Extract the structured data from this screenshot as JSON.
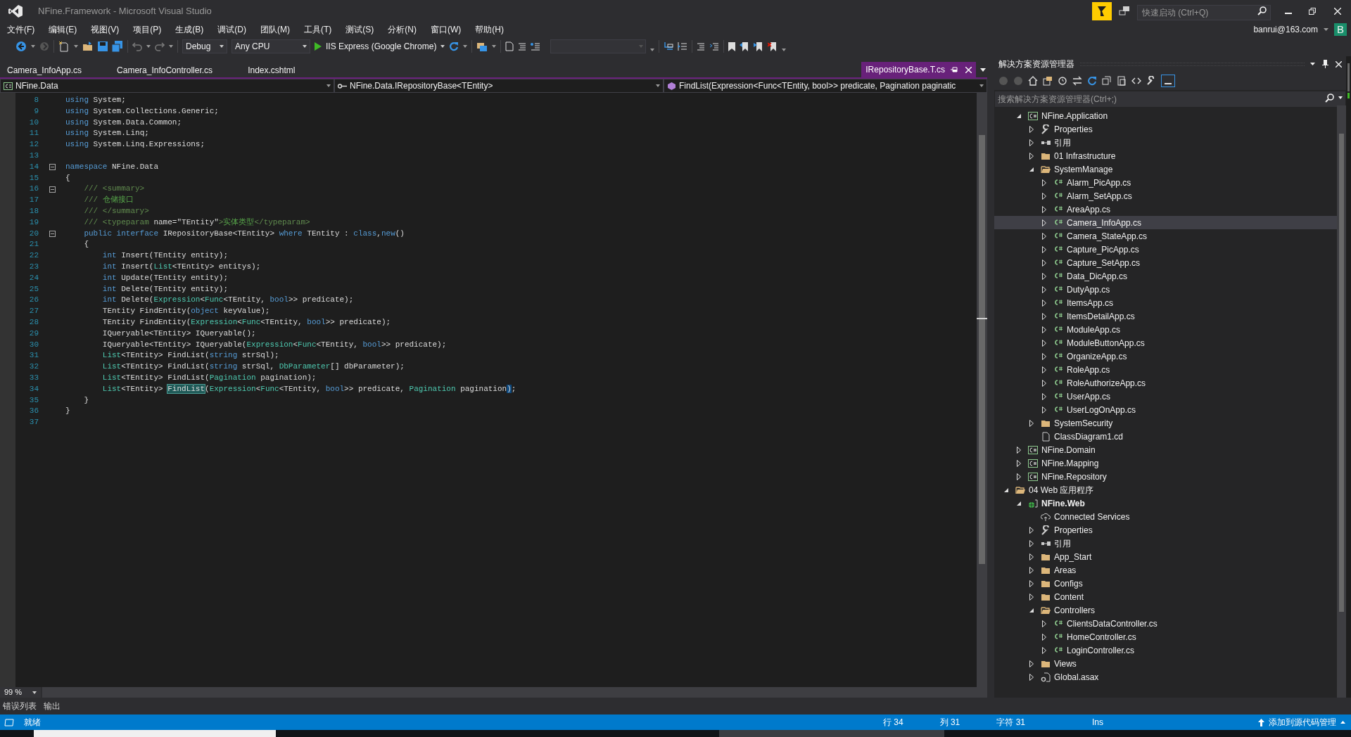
{
  "window": {
    "title": "NFine.Framework - Microsoft Visual Studio",
    "quick_launch": {
      "placeholder": "快速启动 (Ctrl+Q)"
    },
    "account": {
      "user": "banrui@163.com",
      "avatar": "B"
    }
  },
  "menu": [
    "文件(F)",
    "编辑(E)",
    "视图(V)",
    "项目(P)",
    "生成(B)",
    "调试(D)",
    "团队(M)",
    "工具(T)",
    "测试(S)",
    "分析(N)",
    "窗口(W)",
    "帮助(H)"
  ],
  "toolbar": {
    "configuration": "Debug",
    "platform": "Any CPU",
    "run_target": "IIS Express (Google Chrome)"
  },
  "tabs": [
    {
      "label": "Camera_InfoApp.cs",
      "selected": false
    },
    {
      "label": "Camera_InfoController.cs",
      "selected": false
    },
    {
      "label": "Index.cshtml",
      "selected": false
    },
    {
      "label": "IRepositoryBase.T.cs",
      "selected": true
    }
  ],
  "navigation": [
    "NFine.Data",
    "NFine.Data.IRepositoryBase<TEntity>",
    "FindList(Expression<Func<TEntity, bool>> predicate, Pagination paginatic"
  ],
  "code_lines": [
    {
      "number": "8",
      "fold": false,
      "segments": [
        {
          "text": "using",
          "kind": "kw"
        },
        {
          "text": " System;",
          "kind": "plain"
        }
      ]
    },
    {
      "number": "9",
      "fold": false,
      "segments": [
        {
          "text": "using",
          "kind": "kw"
        },
        {
          "text": " System.Collections.Generic;",
          "kind": "plain"
        }
      ]
    },
    {
      "number": "10",
      "fold": false,
      "segments": [
        {
          "text": "using",
          "kind": "kw"
        },
        {
          "text": " System.Data.Common;",
          "kind": "plain"
        }
      ]
    },
    {
      "number": "11",
      "fold": false,
      "segments": [
        {
          "text": "using",
          "kind": "kw"
        },
        {
          "text": " System.Linq;",
          "kind": "plain"
        }
      ]
    },
    {
      "number": "12",
      "fold": false,
      "segments": [
        {
          "text": "using",
          "kind": "kw"
        },
        {
          "text": " System.Linq.Expressions;",
          "kind": "plain"
        }
      ]
    },
    {
      "number": "13",
      "fold": false
    },
    {
      "number": "14",
      "fold": true,
      "segments": [
        {
          "text": "namespace",
          "kind": "kw"
        },
        {
          "text": " NFine.Data",
          "kind": "plain"
        }
      ]
    },
    {
      "number": "15",
      "fold": false,
      "segments": [
        {
          "text": "{",
          "kind": "plain"
        }
      ]
    },
    {
      "number": "16",
      "fold": true,
      "segments": [
        {
          "text": "    /// <summary>",
          "kind": "doc"
        }
      ]
    },
    {
      "number": "17",
      "fold": false,
      "segments": [
        {
          "text": "    /// ",
          "kind": "doc"
        },
        {
          "text": "仓储接口",
          "kind": "comment"
        }
      ]
    },
    {
      "number": "18",
      "fold": false,
      "segments": [
        {
          "text": "    /// </summary>",
          "kind": "doc"
        }
      ]
    },
    {
      "number": "19",
      "fold": false,
      "segments": [
        {
          "text": "    /// <typeparam ",
          "kind": "doc"
        },
        {
          "text": "name=\"TEntity\"",
          "kind": "plain"
        },
        {
          "text": ">",
          "kind": "doc"
        },
        {
          "text": "实体类型",
          "kind": "comment"
        },
        {
          "text": "</typeparam>",
          "kind": "doc"
        }
      ]
    },
    {
      "number": "20",
      "fold": true,
      "segments": [
        {
          "text": "    public interface",
          "kind": "kw"
        },
        {
          "text": " IRepositoryBase<TEntity> ",
          "kind": "plain"
        },
        {
          "text": "where",
          "kind": "kw"
        },
        {
          "text": " TEntity : ",
          "kind": "plain"
        },
        {
          "text": "class",
          "kind": "kw"
        },
        {
          "text": ",",
          "kind": "plain"
        },
        {
          "text": "new",
          "kind": "kw"
        },
        {
          "text": "()",
          "kind": "plain"
        }
      ]
    },
    {
      "number": "21",
      "fold": false,
      "segments": [
        {
          "text": "    {",
          "kind": "plain"
        }
      ]
    },
    {
      "number": "22",
      "fold": false,
      "segments": [
        {
          "text": "        int",
          "kind": "kw"
        },
        {
          "text": " Insert(TEntity entity);",
          "kind": "plain"
        }
      ]
    },
    {
      "number": "23",
      "fold": false,
      "segments": [
        {
          "text": "        int",
          "kind": "kw"
        },
        {
          "text": " Insert(",
          "kind": "plain"
        },
        {
          "text": "List",
          "kind": "type"
        },
        {
          "text": "<TEntity> entitys);",
          "kind": "plain"
        }
      ]
    },
    {
      "number": "24",
      "fold": false,
      "segments": [
        {
          "text": "        int",
          "kind": "kw"
        },
        {
          "text": " Update(TEntity entity);",
          "kind": "plain"
        }
      ]
    },
    {
      "number": "25",
      "fold": false,
      "segments": [
        {
          "text": "        int",
          "kind": "kw"
        },
        {
          "text": " Delete(TEntity entity);",
          "kind": "plain"
        }
      ]
    },
    {
      "number": "26",
      "fold": false,
      "segments": [
        {
          "text": "        int",
          "kind": "kw"
        },
        {
          "text": " Delete(",
          "kind": "plain"
        },
        {
          "text": "Expression",
          "kind": "type"
        },
        {
          "text": "<",
          "kind": "plain"
        },
        {
          "text": "Func",
          "kind": "type"
        },
        {
          "text": "<TEntity, ",
          "kind": "plain"
        },
        {
          "text": "bool",
          "kind": "kw"
        },
        {
          "text": ">> predicate);",
          "kind": "plain"
        }
      ]
    },
    {
      "number": "27",
      "fold": false,
      "segments": [
        {
          "text": "        TEntity FindEntity(",
          "kind": "plain"
        },
        {
          "text": "object",
          "kind": "kw"
        },
        {
          "text": " keyValue);",
          "kind": "plain"
        }
      ]
    },
    {
      "number": "28",
      "fold": false,
      "segments": [
        {
          "text": "        TEntity FindEntity(",
          "kind": "plain"
        },
        {
          "text": "Expression",
          "kind": "type"
        },
        {
          "text": "<",
          "kind": "plain"
        },
        {
          "text": "Func",
          "kind": "type"
        },
        {
          "text": "<TEntity, ",
          "kind": "plain"
        },
        {
          "text": "bool",
          "kind": "kw"
        },
        {
          "text": ">> predicate);",
          "kind": "plain"
        }
      ]
    },
    {
      "number": "29",
      "fold": false,
      "segments": [
        {
          "text": "        IQueryable<TEntity> IQueryable();",
          "kind": "plain"
        }
      ]
    },
    {
      "number": "30",
      "fold": false,
      "segments": [
        {
          "text": "        IQueryable<TEntity> IQueryable(",
          "kind": "plain"
        },
        {
          "text": "Expression",
          "kind": "type"
        },
        {
          "text": "<",
          "kind": "plain"
        },
        {
          "text": "Func",
          "kind": "type"
        },
        {
          "text": "<TEntity, ",
          "kind": "plain"
        },
        {
          "text": "bool",
          "kind": "kw"
        },
        {
          "text": ">> predicate);",
          "kind": "plain"
        }
      ]
    },
    {
      "number": "31",
      "fold": false,
      "segments": [
        {
          "text": "        List",
          "kind": "type"
        },
        {
          "text": "<TEntity> FindList(",
          "kind": "plain"
        },
        {
          "text": "string",
          "kind": "kw"
        },
        {
          "text": " strSql);",
          "kind": "plain"
        }
      ]
    },
    {
      "number": "32",
      "fold": false,
      "segments": [
        {
          "text": "        List",
          "kind": "type"
        },
        {
          "text": "<TEntity> FindList(",
          "kind": "plain"
        },
        {
          "text": "string",
          "kind": "kw"
        },
        {
          "text": " strSql, ",
          "kind": "plain"
        },
        {
          "text": "DbParameter",
          "kind": "type"
        },
        {
          "text": "[] dbParameter);",
          "kind": "plain"
        }
      ]
    },
    {
      "number": "33",
      "fold": false,
      "segments": [
        {
          "text": "        List",
          "kind": "type"
        },
        {
          "text": "<TEntity> FindList(",
          "kind": "plain"
        },
        {
          "text": "Pagination",
          "kind": "type"
        },
        {
          "text": " pagination);",
          "kind": "plain"
        }
      ]
    },
    {
      "number": "34",
      "fold": false,
      "segments": [
        {
          "text": "        List",
          "kind": "type"
        },
        {
          "text": "<TEntity> ",
          "kind": "plain"
        },
        {
          "text": "FindList",
          "kind": "match"
        },
        {
          "text": "(",
          "kind": "plain"
        },
        {
          "text": "Expression",
          "kind": "type"
        },
        {
          "text": "<",
          "kind": "plain"
        },
        {
          "text": "Func",
          "kind": "type"
        },
        {
          "text": "<TEntity, ",
          "kind": "plain"
        },
        {
          "text": "bool",
          "kind": "kw"
        },
        {
          "text": ">> predicate, ",
          "kind": "plain"
        },
        {
          "text": "Pagination",
          "kind": "type"
        },
        {
          "text": " pagination",
          "kind": "plain"
        },
        {
          "text": ")",
          "kind": "brace"
        },
        {
          "text": ";",
          "kind": "plain"
        }
      ]
    },
    {
      "number": "35",
      "fold": false,
      "segments": [
        {
          "text": "    }",
          "kind": "plain"
        }
      ]
    },
    {
      "number": "36",
      "fold": false,
      "segments": [
        {
          "text": "}",
          "kind": "plain"
        }
      ]
    },
    {
      "number": "37",
      "fold": false
    }
  ],
  "zoom": "99 %",
  "solution_explorer": {
    "title": "解决方案资源管理器",
    "search": {
      "placeholder": "搜索解决方案资源管理器(Ctrl+;)"
    },
    "continued_items": [
      {
        "label": "NFine.Application",
        "kind": "cs-project",
        "expanded": true,
        "selected": false,
        "children": [
          {
            "label": "Properties",
            "kind": "properties",
            "expanded": false,
            "selected": false
          },
          {
            "label": "引用",
            "kind": "references",
            "expanded": false,
            "selected": false
          },
          {
            "label": "01 Infrastructure",
            "kind": "folder",
            "expanded": false,
            "selected": false
          },
          {
            "label": "SystemManage",
            "kind": "folder",
            "expanded": true,
            "selected": false,
            "children": [
              {
                "label": "Alarm_PicApp.cs",
                "kind": "cs-file",
                "expanded": false,
                "selected": false
              },
              {
                "label": "Alarm_SetApp.cs",
                "kind": "cs-file",
                "expanded": false,
                "selected": false
              },
              {
                "label": "AreaApp.cs",
                "kind": "cs-file",
                "expanded": false,
                "selected": false
              },
              {
                "label": "Camera_InfoApp.cs",
                "kind": "cs-file",
                "expanded": false,
                "selected": true
              },
              {
                "label": "Camera_StateApp.cs",
                "kind": "cs-file",
                "expanded": false,
                "selected": false
              },
              {
                "label": "Capture_PicApp.cs",
                "kind": "cs-file",
                "expanded": false,
                "selected": false
              },
              {
                "label": "Capture_SetApp.cs",
                "kind": "cs-file",
                "expanded": false,
                "selected": false
              },
              {
                "label": "Data_DicApp.cs",
                "kind": "cs-file",
                "expanded": false,
                "selected": false
              },
              {
                "label": "DutyApp.cs",
                "kind": "cs-file",
                "expanded": false,
                "selected": false
              },
              {
                "label": "ItemsApp.cs",
                "kind": "cs-file",
                "expanded": false,
                "selected": false
              },
              {
                "label": "ItemsDetailApp.cs",
                "kind": "cs-file",
                "expanded": false,
                "selected": false
              },
              {
                "label": "ModuleApp.cs",
                "kind": "cs-file",
                "expanded": false,
                "selected": false
              },
              {
                "label": "ModuleButtonApp.cs",
                "kind": "cs-file",
                "expanded": false,
                "selected": false
              },
              {
                "label": "OrganizeApp.cs",
                "kind": "cs-file",
                "expanded": false,
                "selected": false
              },
              {
                "label": "RoleApp.cs",
                "kind": "cs-file",
                "expanded": false,
                "selected": false
              },
              {
                "label": "RoleAuthorizeApp.cs",
                "kind": "cs-file",
                "expanded": false,
                "selected": false
              },
              {
                "label": "UserApp.cs",
                "kind": "cs-file",
                "expanded": false,
                "selected": false
              },
              {
                "label": "UserLogOnApp.cs",
                "kind": "cs-file",
                "expanded": false,
                "selected": false
              }
            ]
          },
          {
            "label": "SystemSecurity",
            "kind": "folder",
            "expanded": false,
            "selected": false
          },
          {
            "label": "ClassDiagram1.cd",
            "kind": "document",
            "selected": false
          }
        ]
      },
      {
        "label": "NFine.Domain",
        "kind": "cs-project",
        "expanded": false,
        "selected": false
      },
      {
        "label": "NFine.Mapping",
        "kind": "cs-project",
        "expanded": false,
        "selected": false
      },
      {
        "label": "NFine.Repository",
        "kind": "cs-project",
        "expanded": false,
        "selected": false
      }
    ],
    "items": [
      {
        "label": "04 Web 应用程序",
        "kind": "folder",
        "expanded": true,
        "selected": false,
        "children": [
          {
            "label": "NFine.Web",
            "kind": "web-project",
            "expanded": true,
            "selected": false,
            "startup": true,
            "children": [
              {
                "label": "Connected Services",
                "kind": "services",
                "selected": false
              },
              {
                "label": "Properties",
                "kind": "properties",
                "expanded": false,
                "selected": false
              },
              {
                "label": "引用",
                "kind": "references",
                "expanded": false,
                "selected": false
              },
              {
                "label": "App_Start",
                "kind": "folder",
                "expanded": false,
                "selected": false
              },
              {
                "label": "Areas",
                "kind": "folder",
                "expanded": false,
                "selected": false
              },
              {
                "label": "Configs",
                "kind": "folder",
                "expanded": false,
                "selected": false
              },
              {
                "label": "Content",
                "kind": "folder",
                "expanded": false,
                "selected": false
              },
              {
                "label": "Controllers",
                "kind": "folder",
                "expanded": true,
                "selected": false,
                "children": [
                  {
                    "label": "ClientsDataController.cs",
                    "kind": "cs-file",
                    "expanded": false,
                    "selected": false
                  },
                  {
                    "label": "HomeController.cs",
                    "kind": "cs-file",
                    "expanded": false,
                    "selected": false
                  },
                  {
                    "label": "LoginController.cs",
                    "kind": "cs-file",
                    "expanded": false,
                    "selected": false
                  }
                ]
              },
              {
                "label": "Views",
                "kind": "folder",
                "expanded": false,
                "selected": false
              },
              {
                "label": "Global.asax",
                "kind": "asax",
                "expanded": false,
                "selected": false
              }
            ]
          }
        ]
      }
    ]
  },
  "tool_tabs": [
    "错误列表",
    "输出"
  ],
  "status_bar": {
    "message": "就绪",
    "line": "行 34",
    "column": "列 31",
    "char": "字符 31",
    "mode": "Ins",
    "source_control": "添加到源代码管理"
  }
}
